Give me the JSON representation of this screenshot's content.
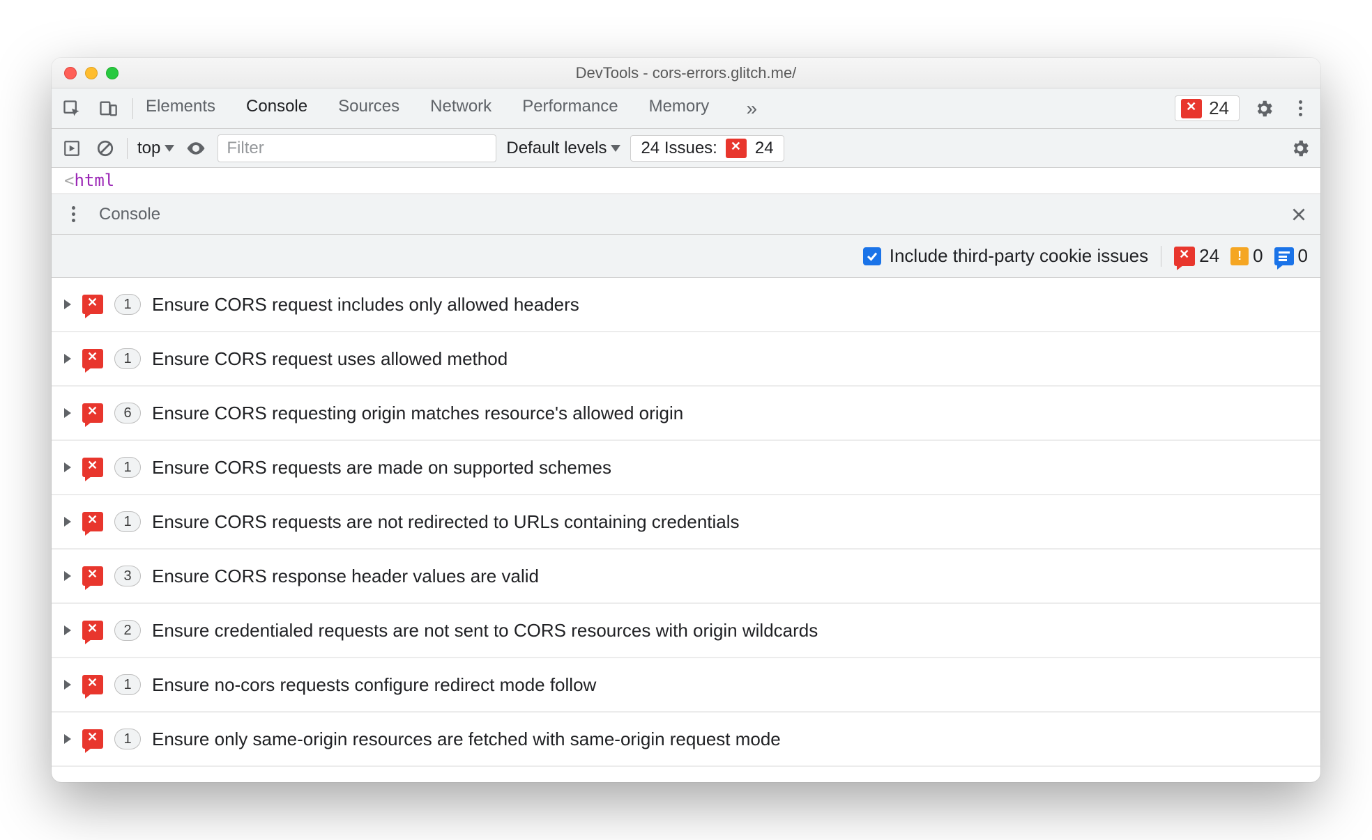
{
  "window": {
    "title": "DevTools - cors-errors.glitch.me/"
  },
  "tabs": {
    "items": [
      "Elements",
      "Console",
      "Sources",
      "Network",
      "Performance",
      "Memory"
    ],
    "active_index": 1,
    "error_count": 24
  },
  "filter_bar": {
    "context_label": "top",
    "filter_placeholder": "Filter",
    "filter_value": "",
    "levels_label": "Default levels",
    "issues_label": "24 Issues:",
    "issues_count": 24
  },
  "code_line": {
    "angle": "<",
    "tag": "html"
  },
  "drawer": {
    "title": "Console"
  },
  "counts_row": {
    "include_label": "Include third-party cookie issues",
    "include_checked": true,
    "errors": 24,
    "warnings": 0,
    "infos": 0
  },
  "issues": [
    {
      "count": 1,
      "title": "Ensure CORS request includes only allowed headers"
    },
    {
      "count": 1,
      "title": "Ensure CORS request uses allowed method"
    },
    {
      "count": 6,
      "title": "Ensure CORS requesting origin matches resource's allowed origin"
    },
    {
      "count": 1,
      "title": "Ensure CORS requests are made on supported schemes"
    },
    {
      "count": 1,
      "title": "Ensure CORS requests are not redirected to URLs containing credentials"
    },
    {
      "count": 3,
      "title": "Ensure CORS response header values are valid"
    },
    {
      "count": 2,
      "title": "Ensure credentialed requests are not sent to CORS resources with origin wildcards"
    },
    {
      "count": 1,
      "title": "Ensure no-cors requests configure redirect mode follow"
    },
    {
      "count": 1,
      "title": "Ensure only same-origin resources are fetched with same-origin request mode"
    }
  ]
}
